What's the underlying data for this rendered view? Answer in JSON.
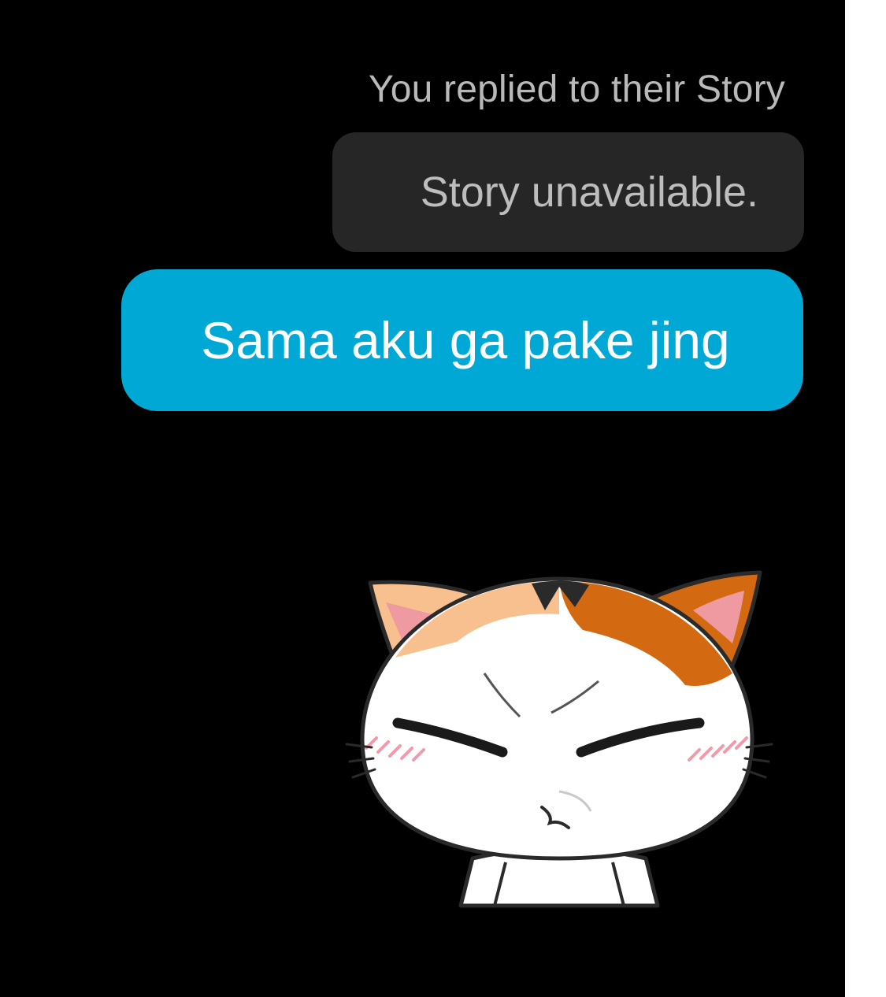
{
  "conversation": {
    "reply_caption": "You replied to their Story",
    "story_placeholder": "Story unavailable.",
    "message_text": "Sama aku ga pake jing",
    "sticker_icon": "angry-cat-sticker-icon"
  },
  "colors": {
    "background": "#000000",
    "story_bubble": "#262626",
    "message_bubble": "#00a8d6",
    "caption_text": "#b9b9b9"
  }
}
